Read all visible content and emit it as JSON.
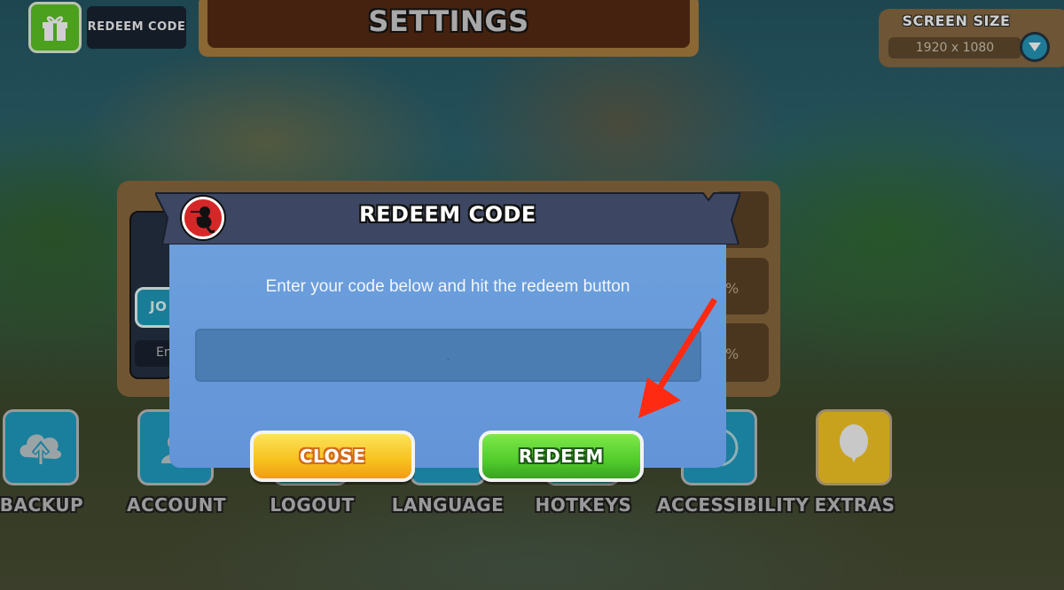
{
  "top_left": {
    "gift_icon": "gift-icon",
    "redeem_code_label": "REDEEM CODE"
  },
  "header": {
    "title": "SETTINGS"
  },
  "screen_size": {
    "title": "SCREEN SIZE",
    "value": "1920 x 1080",
    "dropdown_icon": "triangle-down-icon"
  },
  "background_panel": {
    "join_label": "JO",
    "entry_label": "En",
    "percent_1": "%",
    "percent_2": "%"
  },
  "dialog": {
    "title": "REDEEM CODE",
    "badge_icon": "ninja-monkey-icon",
    "instruction": "Enter your code below and hit the redeem button",
    "code_input": {
      "value": "",
      "placeholder": "."
    },
    "close_label": "CLOSE",
    "redeem_label": "REDEEM"
  },
  "bottom_menu": [
    {
      "label": "BACKUP",
      "icon": "cloud-upload-icon"
    },
    {
      "label": "ACCOUNT",
      "icon": "account-icon"
    },
    {
      "label": "LOGOUT",
      "icon": "logout-icon"
    },
    {
      "label": "LANGUAGE",
      "icon": "language-icon"
    },
    {
      "label": "HOTKEYS",
      "icon": "hotkeys-icon"
    },
    {
      "label": "ACCESSIBILITY",
      "icon": "accessibility-icon"
    },
    {
      "label": "EXTRAS",
      "icon": "balloon-icon"
    }
  ],
  "annotation": {
    "arrow_color": "#ff2a12"
  },
  "colors": {
    "dialog_blue": "#6394d8",
    "close_yellow": "#f7c11d",
    "redeem_green": "#52cc2c",
    "ribbon_navy": "#3d4763"
  }
}
